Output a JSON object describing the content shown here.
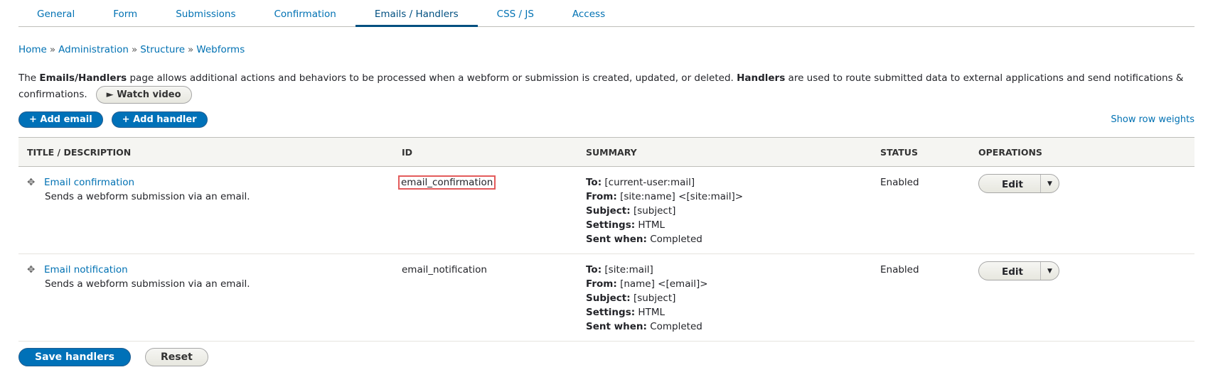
{
  "tabs": [
    "General",
    "Form",
    "Submissions",
    "Confirmation",
    "Emails / Handlers",
    "CSS / JS",
    "Access"
  ],
  "active_tab": "Emails / Handlers",
  "breadcrumb": [
    "Home",
    "Administration",
    "Structure",
    "Webforms"
  ],
  "breadcrumb_sep": "»",
  "description": {
    "p1": "The ",
    "b1": "Emails/Handlers",
    "p2": " page allows additional actions and behaviors to be processed when a webform or submission is created, updated, or deleted. ",
    "b2": "Handlers",
    "p3": " are used to route submitted data to external applications and send notifications & confirmations.",
    "watch": "► Watch video"
  },
  "buttons": {
    "add_email": "+ Add email",
    "add_handler": "+ Add handler",
    "show_weights": "Show row weights",
    "save": "Save handlers",
    "reset": "Reset"
  },
  "table": {
    "headers": [
      "TITLE / DESCRIPTION",
      "ID",
      "SUMMARY",
      "STATUS",
      "OPERATIONS"
    ],
    "rows": [
      {
        "title": "Email confirmation",
        "description": "Sends a webform submission via an email.",
        "id": "email_confirmation",
        "to": "[current-user:mail]",
        "from": "[site:name] <[site:mail]>",
        "subject": "[subject]",
        "settings": "HTML",
        "sent_when": "Completed",
        "status": "Enabled",
        "op": "Edit"
      },
      {
        "title": "Email notification",
        "description": "Sends a webform submission via an email.",
        "id": "email_notification",
        "to": "[site:mail]",
        "from": "[name] <[email]>",
        "subject": "[subject]",
        "settings": "HTML",
        "sent_when": "Completed",
        "status": "Enabled",
        "op": "Edit"
      }
    ],
    "labels": {
      "to": "To:",
      "from": "From:",
      "subject": "Subject:",
      "settings": "Settings:",
      "sent_when": "Sent when:"
    }
  }
}
